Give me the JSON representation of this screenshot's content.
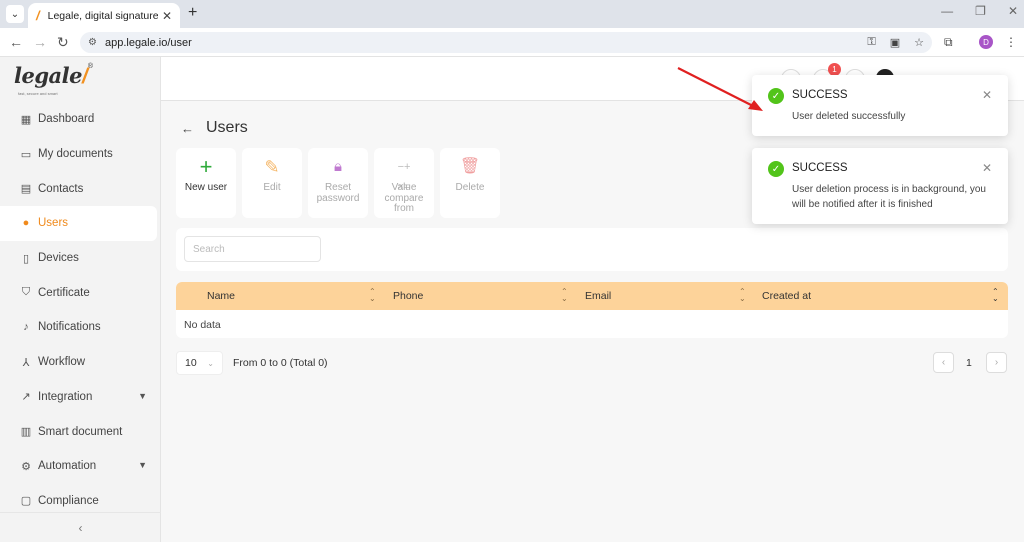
{
  "browser": {
    "tab_title": "Legale, digital signature",
    "url": "app.legale.io/user",
    "profile_initial": "D"
  },
  "logo": {
    "text": "legale",
    "mark": "/",
    "registered": "®",
    "tagline": "fast, secure and smart"
  },
  "sidebar": {
    "items": [
      {
        "label": "Dashboard",
        "icon": "dashboard-icon"
      },
      {
        "label": "My documents",
        "icon": "folder-icon"
      },
      {
        "label": "Contacts",
        "icon": "contacts-icon"
      },
      {
        "label": "Users",
        "icon": "user-icon"
      },
      {
        "label": "Devices",
        "icon": "tablet-icon"
      },
      {
        "label": "Certificate",
        "icon": "shield-icon"
      },
      {
        "label": "Notifications",
        "icon": "bell-icon"
      },
      {
        "label": "Workflow",
        "icon": "workflow-icon"
      },
      {
        "label": "Integration",
        "icon": "external-link-icon"
      },
      {
        "label": "Smart document",
        "icon": "document-icon"
      },
      {
        "label": "Automation",
        "icon": "gear-icon"
      },
      {
        "label": "Compliance",
        "icon": "chat-icon"
      }
    ],
    "active": "Users",
    "collapse_glyph": "‹"
  },
  "topbar": {
    "notification_count": "1"
  },
  "page": {
    "title": "Users"
  },
  "actions": [
    {
      "label": "New user",
      "enabled": true
    },
    {
      "label": "Edit",
      "enabled": false
    },
    {
      "label": "Reset password",
      "enabled": false
    },
    {
      "label": "Value compare from",
      "enabled": false
    },
    {
      "label": "Delete",
      "enabled": false
    }
  ],
  "search": {
    "placeholder": "Search",
    "value": ""
  },
  "table": {
    "columns": [
      "Name",
      "Phone",
      "Email",
      "Created at"
    ],
    "empty_text": "No data"
  },
  "pagination": {
    "page_size": "10",
    "range_text": "From 0 to 0 (Total 0)",
    "current_page": "1"
  },
  "toasts": [
    {
      "title": "SUCCESS",
      "message": "User deleted successfully"
    },
    {
      "title": "SUCCESS",
      "message": "User deletion process is in background, you will be notified after it is finished"
    }
  ],
  "colors": {
    "accent": "#f08a1c",
    "table_header": "#fdd39a",
    "success": "#52c41a",
    "badge": "#f05050",
    "arrow": "#e02020"
  }
}
